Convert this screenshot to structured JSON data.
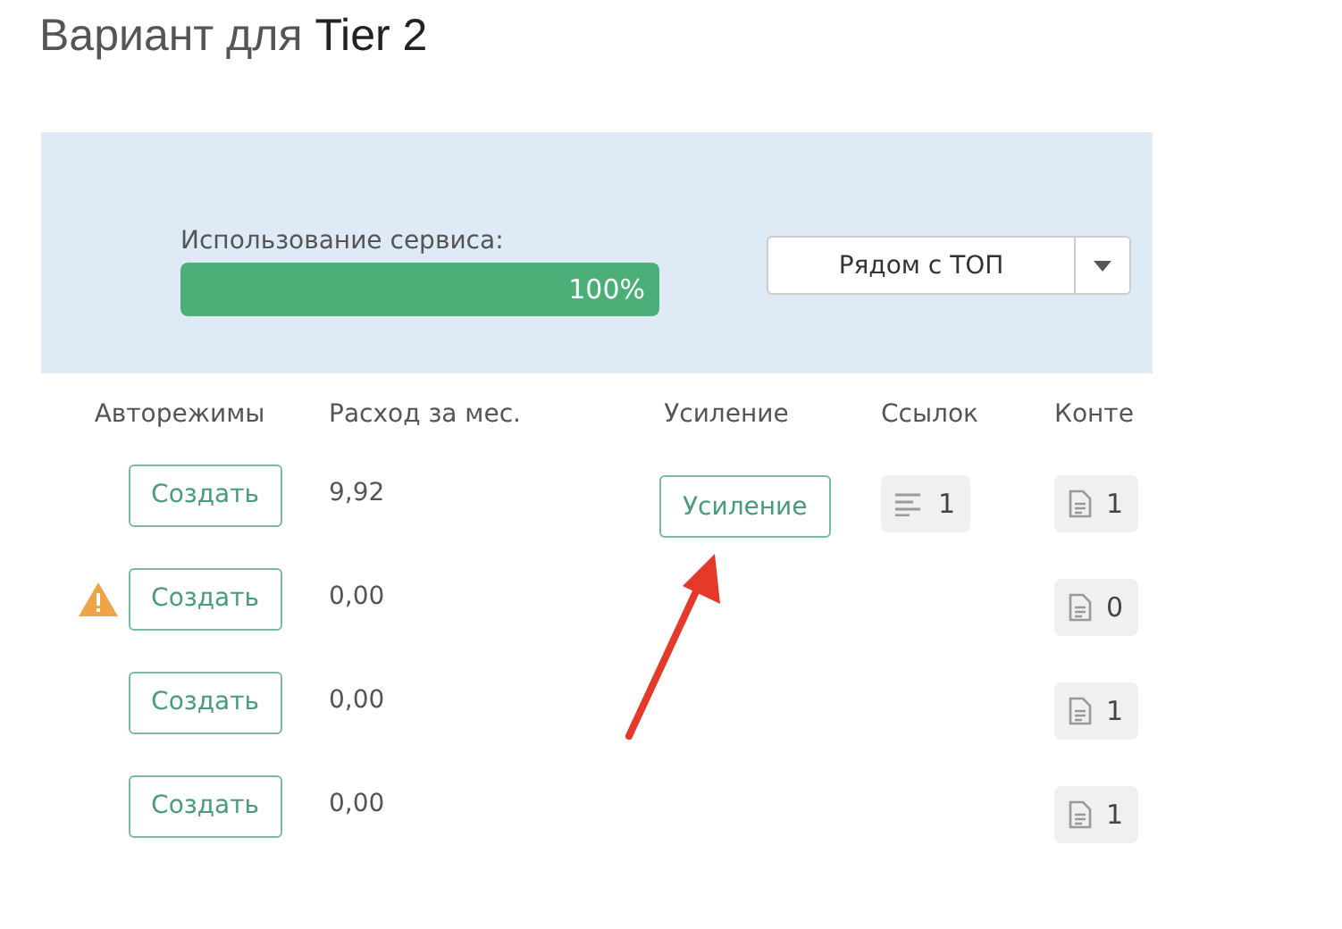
{
  "title": {
    "text": "Вариант для",
    "emphasis": "Tier 2"
  },
  "usage": {
    "label": "Использование сервиса:",
    "level": 1,
    "reading": "100%"
  },
  "mode_select": {
    "value": "Рядом с ТОП"
  },
  "table": {
    "columns": [
      "Авторежимы",
      "Расход за мес.",
      "Усиление",
      "Ссылок",
      "Конте"
    ],
    "rows": [
      {
        "warning": false,
        "create_label": "Создать",
        "spend": "9,92",
        "boost_label": "Усиление",
        "links": "1",
        "content": "1"
      },
      {
        "warning": true,
        "create_label": "Создать",
        "spend": "0,00",
        "content": "0"
      },
      {
        "warning": false,
        "create_label": "Создать",
        "spend": "0,00",
        "content": "1"
      },
      {
        "warning": false,
        "create_label": "Создать",
        "spend": "0,00",
        "content": "1"
      }
    ]
  }
}
